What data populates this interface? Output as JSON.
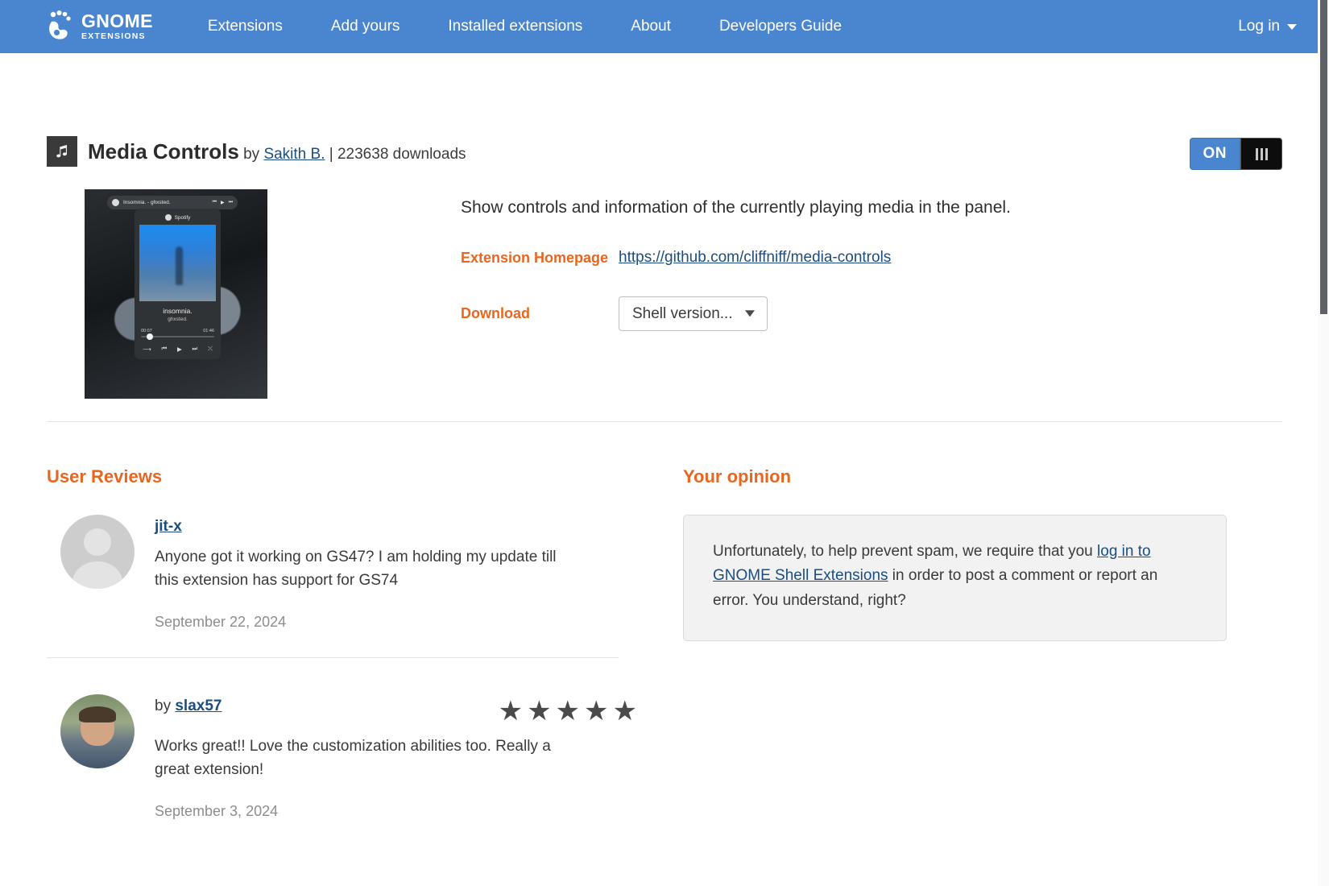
{
  "navbar": {
    "brand": {
      "line1": "GNOME",
      "line2": "EXTENSIONS",
      "logo_icon": "gnome-foot-logo"
    },
    "links": [
      {
        "label": "Extensions"
      },
      {
        "label": "Add yours"
      },
      {
        "label": "Installed extensions"
      },
      {
        "label": "About"
      },
      {
        "label": "Developers Guide"
      }
    ],
    "login": {
      "label": "Log in",
      "caret_icon": "chevron-down-icon"
    }
  },
  "extension": {
    "icon_name": "music-note-icon",
    "name": "Media Controls",
    "by_label": "by",
    "author": "Sakith B.",
    "separator": "|",
    "downloads": "223638 downloads",
    "toggle": {
      "on_label": "ON",
      "prefs_icon": "sliders-icon"
    },
    "description": "Show controls and information of the currently playing media in the panel.",
    "homepage_label": "Extension Homepage",
    "homepage_url": "https://github.com/cliffniff/media-controls",
    "download_label": "Download",
    "shell_version_placeholder": "Shell version...",
    "shell_version_options": [
      "Shell version..."
    ],
    "screenshot": {
      "panel_title": "Insomnia. - ghxsted.",
      "app_label": "Spotify",
      "track": "insomnia.",
      "artist": "ghxsted.",
      "time_elapsed": "00:07",
      "time_total": "01:46",
      "controls": [
        "⟶",
        "⏮",
        "▶",
        "⏭",
        "⤬"
      ],
      "panel_controls": [
        "⏮",
        "▶",
        "⏭"
      ]
    }
  },
  "reviews": {
    "section_title": "User Reviews",
    "items": [
      {
        "avatar_type": "default",
        "by_label": "",
        "author": "jit-x",
        "text": "Anyone got it working on GS47? I am holding my update till this extension has support for GS74",
        "date": "September 22, 2024",
        "stars": 0
      },
      {
        "avatar_type": "photo",
        "by_label": "by ",
        "author": "slax57",
        "text": "Works great!! Love the customization abilities too. Really a great extension!",
        "date": "September 3, 2024",
        "stars": 5
      }
    ]
  },
  "opinion": {
    "section_title": "Your opinion",
    "text_before": "Unfortunately, to help prevent spam, we require that you ",
    "link": "log in to GNOME Shell Extensions",
    "text_after": " in order to post a comment or report an error. You understand, right?"
  },
  "colors": {
    "navbar_blue": "#4a86cf",
    "accent_orange": "#e8661f",
    "link_blue": "#1a4d80",
    "toggle_on": "#4a86cf",
    "star_gray": "#4a4a4a"
  }
}
